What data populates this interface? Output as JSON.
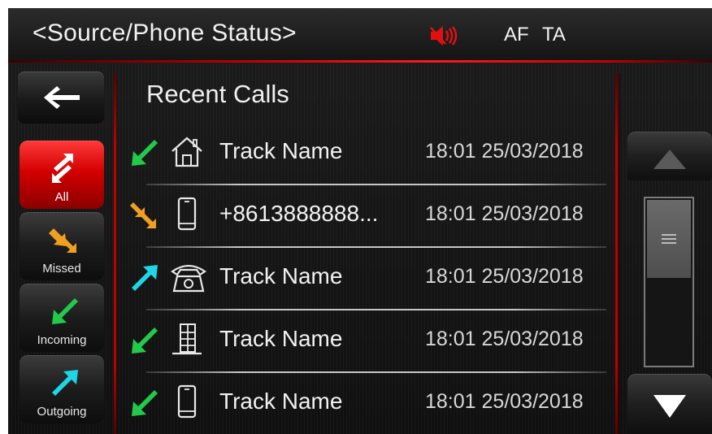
{
  "header": {
    "title": "<Source/Phone Status>",
    "mute_icon": "speaker-muted-icon",
    "af": "AF",
    "ta": "TA",
    "accent_color": "#e00000"
  },
  "nav": {
    "back_icon": "arrow-left-icon"
  },
  "filters": [
    {
      "label": "All",
      "icon": "all-calls-icon",
      "active": true
    },
    {
      "label": "Missed",
      "icon": "missed-call-icon",
      "active": false
    },
    {
      "label": "Incoming",
      "icon": "incoming-call-icon",
      "active": false
    },
    {
      "label": "Outgoing",
      "icon": "outgoing-call-icon",
      "active": false
    }
  ],
  "list": {
    "title": "Recent Calls",
    "calls": [
      {
        "direction": "incoming",
        "device": "home",
        "name": "Track Name",
        "time": "18:01 25/03/2018"
      },
      {
        "direction": "missed",
        "device": "mobile",
        "name": "+8613888888...",
        "time": "18:01 25/03/2018"
      },
      {
        "direction": "outgoing",
        "device": "landline",
        "name": "Track Name",
        "time": "18:01 25/03/2018"
      },
      {
        "direction": "incoming",
        "device": "office",
        "name": "Track Name",
        "time": "18:01 25/03/2018"
      },
      {
        "direction": "incoming",
        "device": "mobile",
        "name": "Track Name",
        "time": "18:01 25/03/2018"
      }
    ]
  },
  "scroll": {
    "position_fraction": 0.0,
    "visible_fraction": 0.46
  },
  "colors": {
    "incoming": "#22c94a",
    "missed": "#f0a020",
    "outgoing": "#1fd6e6"
  }
}
